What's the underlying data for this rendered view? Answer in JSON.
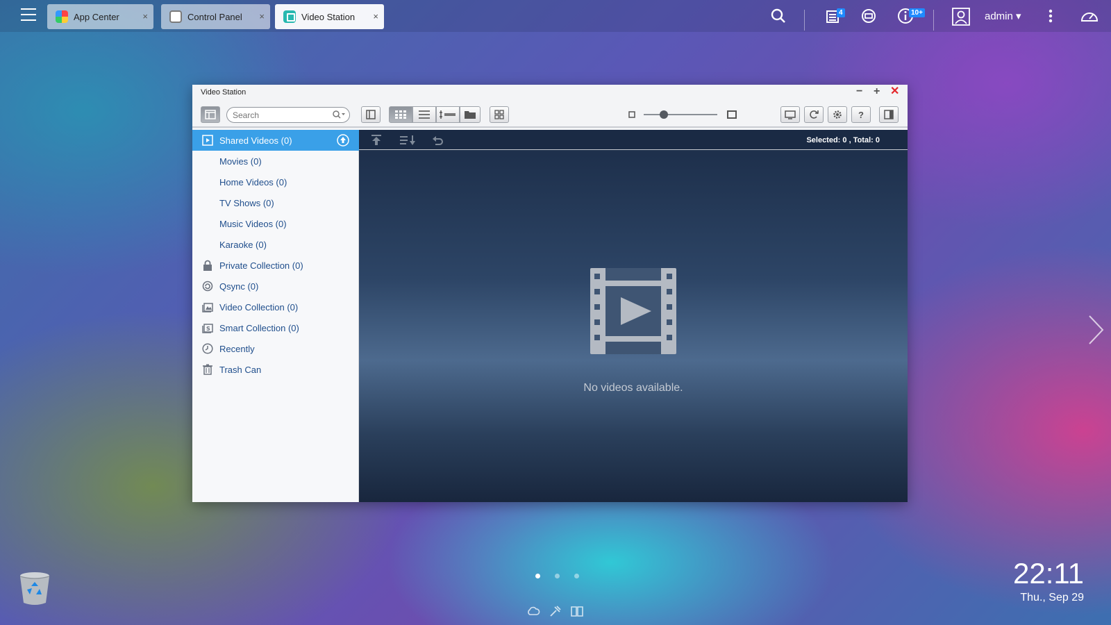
{
  "topbar": {
    "tabs": [
      {
        "label": "App Center",
        "icon": "app-center-icon"
      },
      {
        "label": "Control Panel",
        "icon": "gear-icon"
      },
      {
        "label": "Video Station",
        "icon": "video-station-icon"
      }
    ],
    "tab_close_glyph": "×",
    "notifications_badge": "4",
    "info_badge": "10+",
    "user": "admin",
    "user_caret": "▾"
  },
  "window": {
    "title": "Video Station",
    "minimize": "−",
    "maximize": "+",
    "close": "✕",
    "search_placeholder": "Search"
  },
  "sidebar": {
    "items": [
      {
        "label": "Shared Videos (0)",
        "icon": "film-icon"
      },
      {
        "label": "Movies (0)"
      },
      {
        "label": "Home Videos (0)"
      },
      {
        "label": "TV Shows (0)"
      },
      {
        "label": "Music Videos (0)"
      },
      {
        "label": "Karaoke (0)"
      },
      {
        "label": "Private Collection (0)",
        "icon": "lock-icon"
      },
      {
        "label": "Qsync (0)",
        "icon": "sync-icon"
      },
      {
        "label": "Video Collection (0)",
        "icon": "collection-icon"
      },
      {
        "label": "Smart Collection (0)",
        "icon": "smart-collection-icon"
      },
      {
        "label": "Recently",
        "icon": "clock-icon"
      },
      {
        "label": "Trash Can",
        "icon": "trash-icon"
      }
    ]
  },
  "content": {
    "selected_label": "Selected: 0  , Total: 0",
    "empty_message": "No videos available."
  },
  "desktop": {
    "time": "22:11",
    "date": "Thu., Sep 29",
    "pages": 3,
    "active_page": 1
  },
  "colors": {
    "accent": "#3aa0e8",
    "badge": "#1f8bff",
    "close_red": "#e3272b",
    "nav_text": "#1f4e8c"
  }
}
